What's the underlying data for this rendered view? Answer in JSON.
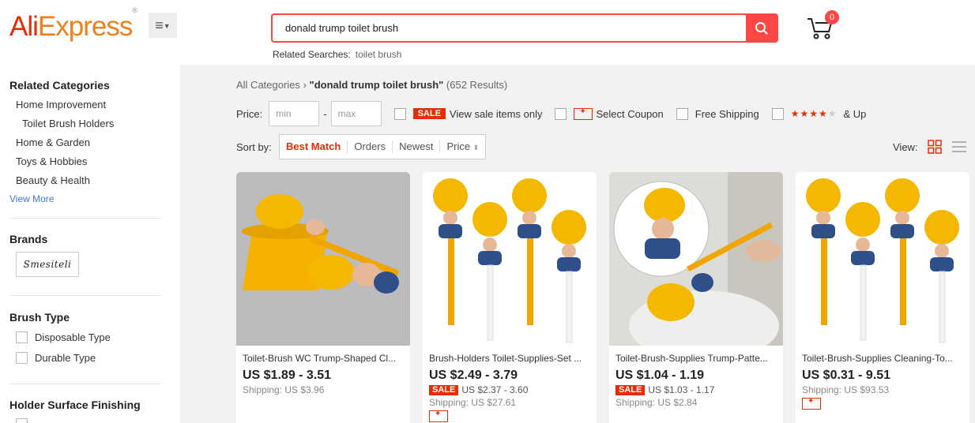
{
  "header": {
    "logo_prefix": "Ali",
    "logo_suffix": "Express",
    "logo_mark": "®",
    "search_value": "donald trump toilet brush",
    "related_label": "Related Searches:",
    "related_link": "toilet brush",
    "cart_count": "0"
  },
  "sidebar": {
    "related_title": "Related Categories",
    "categories": [
      "Home Improvement",
      "Toilet Brush Holders",
      "Home & Garden",
      "Toys & Hobbies",
      "Beauty & Health"
    ],
    "view_more": "View More",
    "brands_title": "Brands",
    "brand_name": "Smesiteli",
    "brush_title": "Brush Type",
    "brush_options": [
      "Disposable Type",
      "Durable Type"
    ],
    "holder_title": "Holder Surface Finishing"
  },
  "breadcrumb": {
    "root": "All Categories",
    "sep": "›",
    "query": "\"donald trump toilet brush\"",
    "results": "(652 Results)"
  },
  "filters": {
    "price_label": "Price:",
    "min_placeholder": "min",
    "max_placeholder": "max",
    "dash": "-",
    "sale_tag": "SALE",
    "sale_label": "View sale items only",
    "coupon_label": "Select Coupon",
    "shipping_label": "Free Shipping",
    "rating_label": "& Up",
    "rating_stars": 4
  },
  "sort": {
    "label": "Sort by:",
    "options": [
      "Best Match",
      "Orders",
      "Newest",
      "Price"
    ],
    "active": "Best Match"
  },
  "view": {
    "label": "View:"
  },
  "products": [
    {
      "title": "Toilet-Brush WC Trump-Shaped Cl...",
      "price": "US $1.89 - 3.51",
      "sale_tag": "",
      "sale_price": "",
      "shipping": "Shipping: US $3.96",
      "coupon": false
    },
    {
      "title": "Brush-Holders Toilet-Supplies-Set ...",
      "price": "US $2.49 - 3.79",
      "sale_tag": "SALE",
      "sale_price": "US $2.37 - 3.60",
      "shipping": "Shipping: US $27.61",
      "coupon": true
    },
    {
      "title": "Toilet-Brush-Supplies Trump-Patte...",
      "price": "US $1.04 - 1.19",
      "sale_tag": "SALE",
      "sale_price": "US $1.03 - 1.17",
      "shipping": "Shipping: US $2.84",
      "coupon": false
    },
    {
      "title": "Toilet-Brush-Supplies Cleaning-To...",
      "price": "US $0.31 - 9.51",
      "sale_tag": "",
      "sale_price": "",
      "shipping": "Shipping: US $93.53",
      "coupon": true
    }
  ],
  "colors": {
    "brand_red": "#e62e04",
    "search_red": "#ff4747",
    "brush_yellow": "#f5b800"
  }
}
